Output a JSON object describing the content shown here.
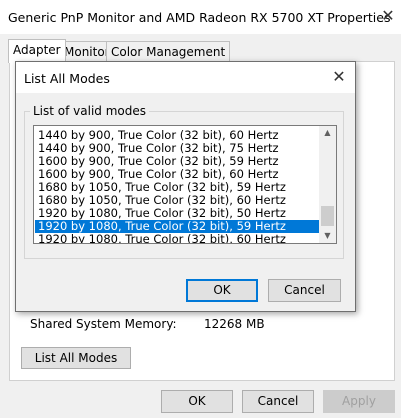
{
  "window": {
    "title": "Generic PnP Monitor and AMD Radeon RX 5700 XT Properties",
    "close_glyph": "✕"
  },
  "tabs": [
    {
      "label": "Adapter"
    },
    {
      "label": "Monitor"
    },
    {
      "label": "Color Management"
    }
  ],
  "adapter_info": {
    "shared_memory_label": "Shared System Memory:",
    "shared_memory_value": "12268 MB"
  },
  "list_all_modes_button": "List All Modes",
  "footer": {
    "ok": "OK",
    "cancel": "Cancel",
    "apply": "Apply"
  },
  "dialog": {
    "title": "List All Modes",
    "close_glyph": "✕",
    "group_label": "List of valid modes",
    "modes": [
      "1440 by 900, True Color (32 bit), 60 Hertz",
      "1440 by 900, True Color (32 bit), 75 Hertz",
      "1600 by 900, True Color (32 bit), 59 Hertz",
      "1600 by 900, True Color (32 bit), 60 Hertz",
      "1680 by 1050, True Color (32 bit), 59 Hertz",
      "1680 by 1050, True Color (32 bit), 60 Hertz",
      "1920 by 1080, True Color (32 bit), 50 Hertz",
      "1920 by 1080, True Color (32 bit), 59 Hertz",
      "1920 by 1080, True Color (32 bit), 60 Hertz"
    ],
    "selected_index": 7,
    "ok": "OK",
    "cancel": "Cancel",
    "scroll_up_glyph": "▲",
    "scroll_down_glyph": "▼"
  },
  "colors": {
    "selection": "#0078d7",
    "window_bg": "#f0f0f0"
  }
}
